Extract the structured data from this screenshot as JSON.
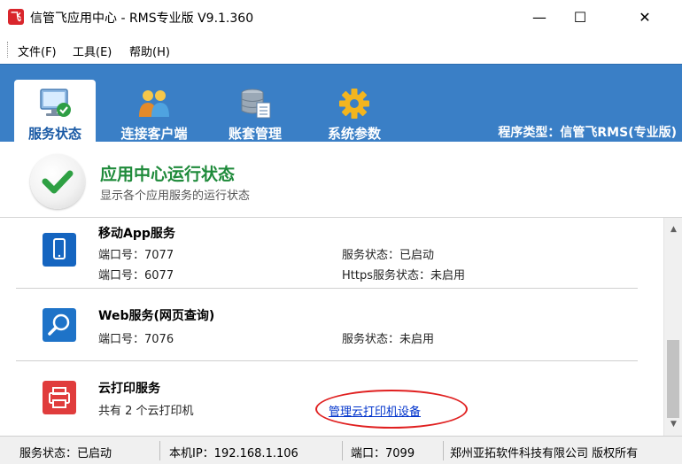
{
  "window": {
    "title": "信管飞应用中心 - RMS专业版 V9.1.360",
    "app_icon_glyph": "飞",
    "minimize": "—",
    "maximize": "☐",
    "close": "✕"
  },
  "menu": {
    "items": [
      {
        "label": "文件(F)"
      },
      {
        "label": "工具(E)"
      },
      {
        "label": "帮助(H)"
      }
    ]
  },
  "toolbar": {
    "tabs": [
      {
        "label": "服务状态",
        "icon": "monitor-check-icon",
        "active": true
      },
      {
        "label": "连接客户端",
        "icon": "users-icon",
        "active": false
      },
      {
        "label": "账套管理",
        "icon": "database-icon",
        "active": false
      },
      {
        "label": "系统参数",
        "icon": "gear-icon",
        "active": false
      }
    ],
    "program_type": "程序类型：信管飞RMS(专业版)"
  },
  "header": {
    "title": "应用中心运行状态",
    "subtitle": "显示各个应用服务的运行状态"
  },
  "services": [
    {
      "name": "移动App服务",
      "icon": "mobile-phone-icon",
      "icon_color": "#1565c0",
      "lines_left": [
        "端口号：7077",
        "端口号：6077"
      ],
      "lines_right": [
        "服务状态：已启动",
        "Https服务状态：未启用"
      ]
    },
    {
      "name": "Web服务(网页查询)",
      "icon": "magnifier-icon",
      "icon_color": "#1e73c8",
      "lines_left": [
        "端口号：7076"
      ],
      "lines_right": [
        "服务状态：未启用"
      ]
    },
    {
      "name": "云打印服务",
      "icon": "printer-icon",
      "icon_color": "#e03c3c",
      "lines_left": [
        "共有 2 个云打印机"
      ],
      "link": "管理云打印机设备"
    }
  ],
  "statusbar": {
    "service_status": "服务状态：已启动",
    "local_ip": "本机IP：192.168.1.106",
    "port": "端口：7099",
    "company": "郑州亚拓软件科技有限公司 版权所有"
  },
  "colors": {
    "toolbar_blue": "#3a7fc6",
    "header_green": "#1e8a3a",
    "link_blue": "#0033cc",
    "highlight_red": "#e02020"
  }
}
